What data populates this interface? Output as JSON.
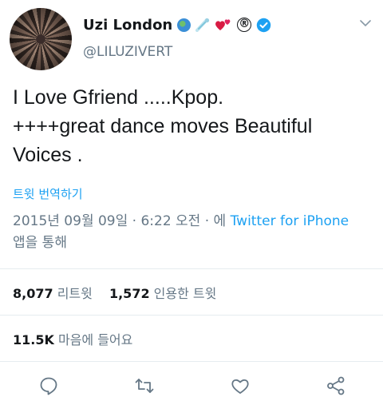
{
  "author": {
    "display_name": "Uzi London",
    "handle": "@LILUZIVERT",
    "emojis": [
      "globe-emoji",
      "comet-emoji",
      "two-hearts-emoji",
      "registered-emoji"
    ],
    "registered_symbol": "®",
    "verified": true
  },
  "tweet": {
    "text_line1": "I Love Gfriend  .....Kpop.",
    "text_line2": "++++great dance moves Beautiful",
    "text_line3": "Voices ."
  },
  "translate_label": "트윗 번역하기",
  "meta": {
    "timestamp": "2015년 09월 09일 · 6:22 오전 · 에 ",
    "via": "Twitter for iPhone",
    "suffix": "앱을 통해"
  },
  "stats": {
    "retweets_count": "8,077",
    "retweets_label": "리트윗",
    "quotes_count": "1,572",
    "quotes_label": "인용한 트윗",
    "likes_count": "11.5K",
    "likes_label": "마음에 들어요"
  },
  "colors": {
    "text": "#14171a",
    "secondary": "#657786",
    "accent": "#1da1f2",
    "divider": "#e6ecf0"
  },
  "actions": [
    "reply-icon",
    "retweet-icon",
    "like-icon",
    "share-icon"
  ]
}
